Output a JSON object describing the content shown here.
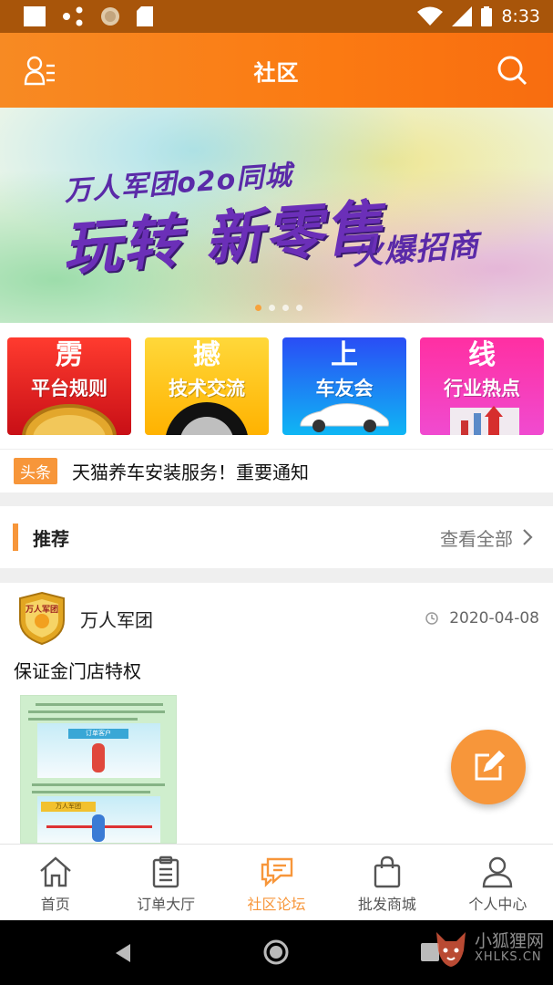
{
  "status_bar": {
    "time": "8:33"
  },
  "header": {
    "title": "社区"
  },
  "banner": {
    "line1": "万人军团o2o同城",
    "line2": "玩转 新零售",
    "line3": "火爆招商",
    "slide_count": 4,
    "active_slide": 0
  },
  "categories": [
    {
      "glyph": "雳",
      "label": "平台规则"
    },
    {
      "glyph": "撼",
      "label": "技术交流"
    },
    {
      "glyph": "上",
      "label": "车友会"
    },
    {
      "glyph": "线",
      "label": "行业热点"
    }
  ],
  "headline": {
    "tag": "头条",
    "text": "天猫养车安装服务！重要通知"
  },
  "recommend": {
    "title": "推荐",
    "more": "查看全部"
  },
  "post": {
    "avatar_text": "万人军团",
    "author": "万人军团",
    "date": "2020-04-08",
    "title": "保证金门店特权",
    "image": {
      "banner1": "订单客户",
      "banner2": "万人军团"
    }
  },
  "bottom_nav": [
    {
      "icon": "home-icon",
      "label": "首页"
    },
    {
      "icon": "clipboard-icon",
      "label": "订单大厅"
    },
    {
      "icon": "chat-icon",
      "label": "社区论坛"
    },
    {
      "icon": "shopping-bag-icon",
      "label": "批发商城"
    },
    {
      "icon": "user-icon",
      "label": "个人中心"
    }
  ],
  "watermark": {
    "name": "小狐狸网",
    "domain": "XHLKS.CN"
  },
  "colors": {
    "accent": "#f7963a",
    "header": "#fb7a12",
    "status_bar": "#a8550a"
  }
}
